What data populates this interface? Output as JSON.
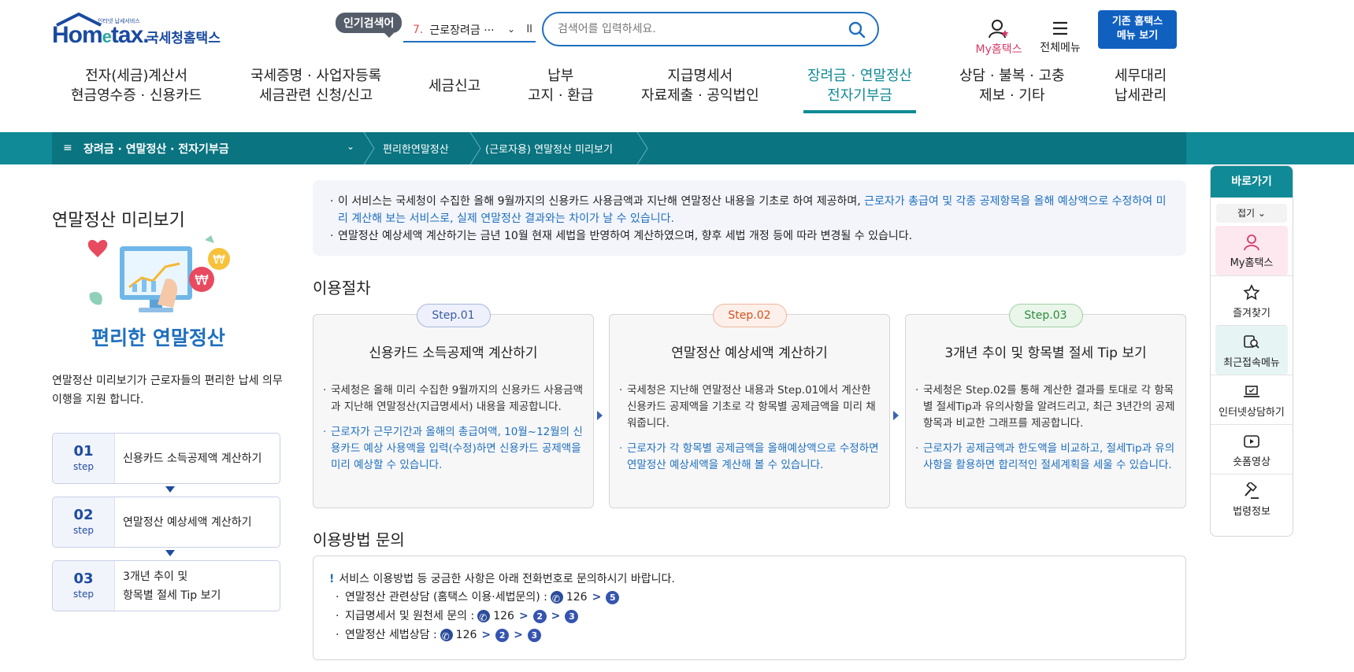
{
  "header": {
    "logo_sub": "인터넷 납세서비스",
    "logo_main_a": "Hom",
    "logo_main_e": "e",
    "logo_main_b": "tax.",
    "logo_kr": "국세청홈택스",
    "popular_badge": "인기검색어",
    "popular_rank": "7.",
    "popular_term": "근로장려금 ···",
    "search_placeholder": "검색어를 입력하세요.",
    "my_hometax": "My홈택스",
    "all_menu": "전체메뉴",
    "old_menu_line1": "기존 홈택스",
    "old_menu_line2": "메뉴 보기"
  },
  "gnb": [
    {
      "l1": "전자(세금)계산서",
      "l2": "현금영수증 · 신용카드"
    },
    {
      "l1": "국세증명 · 사업자등록",
      "l2": "세금관련 신청/신고"
    },
    {
      "l1": "세금신고",
      "l2": ""
    },
    {
      "l1": "납부",
      "l2": "고지 · 환급"
    },
    {
      "l1": "지급명세서",
      "l2": "자료제출 · 공익법인"
    },
    {
      "l1": "장려금 · 연말정산",
      "l2": "전자기부금"
    },
    {
      "l1": "상담 · 불복 · 고충",
      "l2": "제보 · 기타"
    },
    {
      "l1": "세무대리",
      "l2": "납세관리"
    }
  ],
  "breadcrumb": {
    "menu_icon": "≡",
    "level1": "장려금 · 연말정산 · 전자기부금",
    "level2": "편리한연말정산",
    "level3": "(근로자용) 연말정산 미리보기"
  },
  "left": {
    "page_title": "연말정산 미리보기",
    "illust_title": "편리한 연말정산",
    "desc": "연말정산 미리보기가 근로자들의  편리한 납세 의무 이행을 지원 합니다.",
    "step_label": "step",
    "steps": [
      {
        "num": "01",
        "text": "신용카드 소득공제액 계산하기",
        "text2": ""
      },
      {
        "num": "02",
        "text": "연말정산 예상세액 계산하기",
        "text2": ""
      },
      {
        "num": "03",
        "text": "3개년 추이 및",
        "text2": "항목별 절세 Tip 보기"
      }
    ]
  },
  "notice": {
    "line1_a": "이 서비스는 국세청이 수집한 올해 9월까지의 신용카드 사용금액과 지난해 연말정산 내용을 기초로 하여 제공하며, ",
    "line1_b": "근로자가 총급여 및 각종 공제항목을 올해 예상액으로 수정하여 미리 계산해 보는 서비스로, 실제 연말정산 결과와는 차이가 날 수 있습니다.",
    "line2": "연말정산 예상세액 계산하기는 금년 10월 현재 세법을 반영하여 계산하였으며, 향후 세법 개정 등에 따라 변경될 수 있습니다."
  },
  "procedure": {
    "title": "이용절차",
    "cards": [
      {
        "badge": "Step.01",
        "badge_color": "#3a5ba8",
        "badge_bg": "#eef1fb",
        "badge_border": "#a8b6de",
        "title": "신용카드 소득공제액 계산하기",
        "b1": "국세청은 올해 미리 수집한 9월까지의 신용카드 사용금액과 지난해 연말정산(지급명세서) 내용을 제공합니다.",
        "b2": "근로자가 근무기간과 올해의 총급여액, 10월~12월의 신용카드 예상 사용액을 입력(수정)하면 신용카드 공제액을 미리 예상할 수 있습니다."
      },
      {
        "badge": "Step.02",
        "badge_color": "#d4501e",
        "badge_bg": "#fdf0ea",
        "badge_border": "#f0b89e",
        "title": "연말정산 예상세액 계산하기",
        "b1": "국세청은 지난해 연말정산 내용과 Step.01에서 계산한 신용카드 공제액을 기초로 각 항목별 공제금액을 미리 채워줍니다.",
        "b2": "근로자가 각 항목별 공제금액을 올해예상액으로 수정하면 연말정산 예상세액을 계산해 볼 수 있습니다."
      },
      {
        "badge": "Step.03",
        "badge_color": "#2a8a3a",
        "badge_bg": "#eaf6ea",
        "badge_border": "#9ed1a4",
        "title": "3개년 추이 및 항목별 절세 Tip 보기",
        "b1": "국세청은 Step.02를 통해 계산한 결과를 토대로 각 항목별 절세Tip과 유의사항을 알려드리고, 최근 3년간의 공제항목과 비교한 그래프를 제공합니다.",
        "b2": "근로자가 공제금액과 한도액을 비교하고, 절세Tip과 유의사항을 활용하면 합리적인 절세계획을 세울 수 있습니다."
      }
    ]
  },
  "inquiry": {
    "title": "이용방법 문의",
    "excl": "!",
    "head": "서비스 이용방법 등 궁금한 사항은 아래 전화번호로 문의하시기 바랍니다.",
    "rows": [
      {
        "label": "연말정산 관련상담 (홈택스 이용·세법문의) :",
        "number": "126",
        "steps": [
          "5"
        ]
      },
      {
        "label": "지급명세서 및 원천세 문의 :",
        "number": "126",
        "steps": [
          "2",
          "3"
        ]
      },
      {
        "label": "연말정산 세법상담 :",
        "number": "126",
        "steps": [
          "2",
          "3"
        ]
      }
    ],
    "gt": ">"
  },
  "quick": {
    "title": "바로가기",
    "fold": "접기",
    "items": [
      "My홈택스",
      "즐겨찾기",
      "최근접속메뉴",
      "인터넷상담하기",
      "숏폼영상",
      "법령정보"
    ]
  }
}
